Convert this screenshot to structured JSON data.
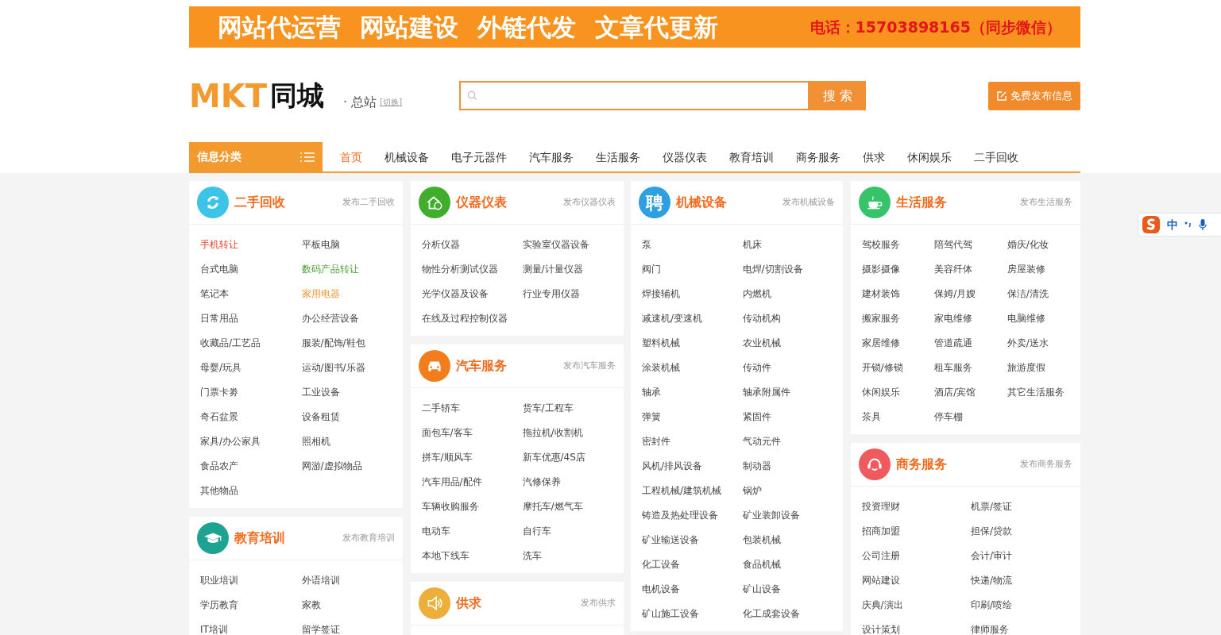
{
  "banner": {
    "slogans": [
      "网站代运营",
      "网站建设",
      "外链代发",
      "文章代更新"
    ],
    "phone": "电话：15703898165（同步微信）"
  },
  "header": {
    "logo_main": "MKT",
    "logo_sub": "同城",
    "station": "· 总站",
    "switch": "[切换]",
    "search_button": "搜 索",
    "publish_button": "免费发布信息"
  },
  "nav": {
    "category_label": "信息分类",
    "tabs": [
      {
        "label": "首页",
        "selected": true
      },
      {
        "label": "机械设备",
        "selected": false
      },
      {
        "label": "电子元器件",
        "selected": false
      },
      {
        "label": "汽车服务",
        "selected": false
      },
      {
        "label": "生活服务",
        "selected": false
      },
      {
        "label": "仪器仪表",
        "selected": false
      },
      {
        "label": "教育培训",
        "selected": false
      },
      {
        "label": "商务服务",
        "selected": false
      },
      {
        "label": "供求",
        "selected": false
      },
      {
        "label": "休闲娱乐",
        "selected": false
      },
      {
        "label": "二手回收",
        "selected": false
      }
    ]
  },
  "columns": [
    [
      {
        "title": "二手回收",
        "publish": "发布二手回收",
        "kind": "refresh",
        "color": "#3cc3e8",
        "items": [
          {
            "label": "手机转让",
            "color": "#e8402a"
          },
          {
            "label": "平板电脑"
          },
          {
            "label": "台式电脑"
          },
          {
            "label": "数码产品转让",
            "color": "#4aa232"
          },
          {
            "label": "笔记本"
          },
          {
            "label": "家用电器",
            "color": "#f39533"
          },
          {
            "label": "日常用品"
          },
          {
            "label": "办公经营设备"
          },
          {
            "label": "收藏品/工艺品"
          },
          {
            "label": "服装/配饰/鞋包"
          },
          {
            "label": "母婴/玩具"
          },
          {
            "label": "运动/图书/乐器"
          },
          {
            "label": "门票卡劵"
          },
          {
            "label": "工业设备"
          },
          {
            "label": "奇石盆景"
          },
          {
            "label": "设备租赁"
          },
          {
            "label": "家具/办公家具"
          },
          {
            "label": "照相机"
          },
          {
            "label": "食品农产"
          },
          {
            "label": "网游/虚拟物品"
          },
          {
            "label": "其他物品"
          }
        ]
      },
      {
        "title": "教育培训",
        "publish": "发布教育培训",
        "kind": "cap",
        "color": "#1ea291",
        "items": [
          {
            "label": "职业培训"
          },
          {
            "label": "外语培训"
          },
          {
            "label": "学历教育"
          },
          {
            "label": "家教"
          },
          {
            "label": "IT培训"
          },
          {
            "label": "留学签证"
          }
        ]
      }
    ],
    [
      {
        "title": "仪器仪表",
        "publish": "发布仪器仪表",
        "kind": "house",
        "color": "#40ad2b",
        "items": [
          {
            "label": "分析仪器"
          },
          {
            "label": "实验室仪器设备"
          },
          {
            "label": "物性分析测试仪器"
          },
          {
            "label": "测量/计量仪器"
          },
          {
            "label": "光学仪器及设备"
          },
          {
            "label": "行业专用仪器"
          },
          {
            "label": "在线及过程控制仪器"
          }
        ]
      },
      {
        "title": "汽车服务",
        "publish": "发布汽车服务",
        "kind": "car",
        "color": "#f27d1c",
        "items": [
          {
            "label": "二手轿车"
          },
          {
            "label": "货车/工程车"
          },
          {
            "label": "面包车/客车"
          },
          {
            "label": "拖拉机/收割机"
          },
          {
            "label": "拼车/顺风车"
          },
          {
            "label": "新车优惠/4S店"
          },
          {
            "label": "汽车用品/配件"
          },
          {
            "label": "汽修保养"
          },
          {
            "label": "车辆收购服务"
          },
          {
            "label": "摩托车/燃气车"
          },
          {
            "label": "电动车"
          },
          {
            "label": "自行车"
          },
          {
            "label": "本地下线车"
          },
          {
            "label": "洗车"
          }
        ]
      },
      {
        "title": "供求",
        "publish": "发布供求",
        "kind": "speaker",
        "color": "#eeae3a"
      }
    ],
    [
      {
        "title": "机械设备",
        "publish": "发布机械设备",
        "kind": "character",
        "icon_text": "聘",
        "color": "#2e9fe0",
        "items": [
          {
            "label": "泵"
          },
          {
            "label": "机床"
          },
          {
            "label": "阀门"
          },
          {
            "label": "电焊/切割设备"
          },
          {
            "label": "焊接辅机"
          },
          {
            "label": "内燃机"
          },
          {
            "label": "减速机/变速机"
          },
          {
            "label": "传动机构"
          },
          {
            "label": "塑料机械"
          },
          {
            "label": "农业机械"
          },
          {
            "label": "涂装机械"
          },
          {
            "label": "传动件"
          },
          {
            "label": "轴承"
          },
          {
            "label": "轴承附属件"
          },
          {
            "label": "弹簧"
          },
          {
            "label": "紧固件"
          },
          {
            "label": "密封件"
          },
          {
            "label": "气动元件"
          },
          {
            "label": "风机/排风设备"
          },
          {
            "label": "制动器"
          },
          {
            "label": "工程机械/建筑机械"
          },
          {
            "label": "锅炉"
          },
          {
            "label": "铸造及热处理设备"
          },
          {
            "label": "矿业装卸设备"
          },
          {
            "label": "矿业输送设备"
          },
          {
            "label": "包装机械"
          },
          {
            "label": "化工设备"
          },
          {
            "label": "食品机械"
          },
          {
            "label": "电机设备"
          },
          {
            "label": "矿山设备"
          },
          {
            "label": "矿山施工设备"
          },
          {
            "label": "化工成套设备"
          }
        ]
      }
    ],
    [
      {
        "title": "生活服务",
        "publish": "发布生活服务",
        "kind": "cup",
        "color": "#36c36a",
        "items": [
          {
            "label": "驾校服务"
          },
          {
            "label": "陪驾代驾"
          },
          {
            "label": "婚庆/化妆"
          },
          {
            "label": "摄影摄像"
          },
          {
            "label": "美容纤体"
          },
          {
            "label": "房屋装修"
          },
          {
            "label": "建材装饰"
          },
          {
            "label": "保姆/月嫂"
          },
          {
            "label": "保洁/清洗"
          },
          {
            "label": "搬家服务"
          },
          {
            "label": "家电维修"
          },
          {
            "label": "电脑维修"
          },
          {
            "label": "家居维修"
          },
          {
            "label": "管道疏通"
          },
          {
            "label": "外卖/送水"
          },
          {
            "label": "开锁/修锁"
          },
          {
            "label": "租车服务"
          },
          {
            "label": "旅游度假"
          },
          {
            "label": "休闲娱乐"
          },
          {
            "label": "酒店/宾馆"
          },
          {
            "label": "其它生活服务"
          },
          {
            "label": "茶具"
          },
          {
            "label": "停车棚"
          }
        ]
      },
      {
        "title": "商务服务",
        "publish": "发布商务服务",
        "kind": "headset",
        "color": "#ef5a5e",
        "items": [
          {
            "label": "投资理财"
          },
          {
            "label": "机票/签证"
          },
          {
            "label": "招商加盟"
          },
          {
            "label": "担保/贷款"
          },
          {
            "label": "公司注册"
          },
          {
            "label": "会计/审计"
          },
          {
            "label": "网站建设"
          },
          {
            "label": "快递/物流"
          },
          {
            "label": "庆典/演出"
          },
          {
            "label": "印刷/喷绘"
          },
          {
            "label": "设计策划"
          },
          {
            "label": "律师服务"
          }
        ]
      }
    ]
  ],
  "ime_toolbar": {
    "mode": "中"
  }
}
